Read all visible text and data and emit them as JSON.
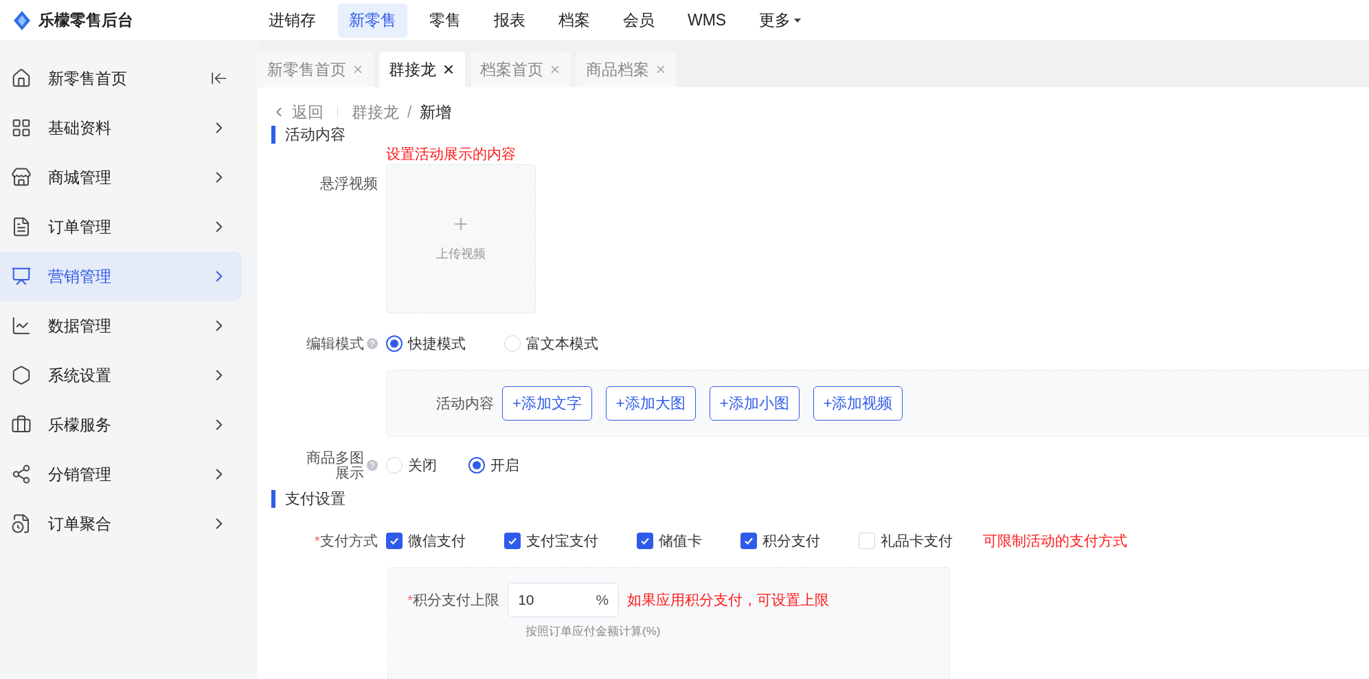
{
  "app": {
    "title": "乐檬零售后台"
  },
  "top_nav": [
    {
      "label": "进销存",
      "selected": false,
      "kind": "link"
    },
    {
      "label": "新零售",
      "selected": true,
      "kind": "link"
    },
    {
      "label": "零售",
      "selected": false,
      "kind": "link"
    },
    {
      "label": "报表",
      "selected": false,
      "kind": "link"
    },
    {
      "label": "档案",
      "selected": false,
      "kind": "link"
    },
    {
      "label": "会员",
      "selected": false,
      "kind": "link"
    },
    {
      "label": "WMS",
      "selected": false,
      "kind": "link"
    },
    {
      "label": "更多",
      "selected": false,
      "kind": "menu"
    }
  ],
  "sidebar": {
    "items": [
      {
        "label": "新零售首页",
        "selected": false,
        "kind": "home"
      },
      {
        "label": "基础资料",
        "selected": false,
        "kind": "group"
      },
      {
        "label": "商城管理",
        "selected": false,
        "kind": "group"
      },
      {
        "label": "订单管理",
        "selected": false,
        "kind": "group"
      },
      {
        "label": "营销管理",
        "selected": true,
        "kind": "group"
      },
      {
        "label": "数据管理",
        "selected": false,
        "kind": "group"
      },
      {
        "label": "系统设置",
        "selected": false,
        "kind": "group"
      },
      {
        "label": "乐檬服务",
        "selected": false,
        "kind": "group"
      },
      {
        "label": "分销管理",
        "selected": false,
        "kind": "group"
      },
      {
        "label": "订单聚合",
        "selected": false,
        "kind": "group"
      }
    ]
  },
  "tabs": [
    {
      "label": "新零售首页",
      "selected": false
    },
    {
      "label": "群接龙",
      "selected": true
    },
    {
      "label": "档案首页",
      "selected": false
    },
    {
      "label": "商品档案",
      "selected": false
    }
  ],
  "breadcrumb": {
    "back": "返回",
    "path": [
      "群接龙",
      "新增"
    ],
    "separator": "/"
  },
  "activity_section": {
    "heading": "活动内容",
    "note": "设置活动展示的内容",
    "floating_video": {
      "label": "悬浮视频",
      "upload": "上传视频"
    },
    "edit_mode": {
      "label": "编辑模式",
      "options": [
        {
          "label": "快捷模式",
          "selected": true
        },
        {
          "label": "富文本模式",
          "selected": false
        }
      ]
    },
    "content_panel": {
      "label": "活动内容",
      "buttons": [
        "+添加文字",
        "+添加大图",
        "+添加小图",
        "+添加视频"
      ]
    },
    "multi_image": {
      "label": "商品多图展示",
      "options": [
        {
          "label": "关闭",
          "selected": false
        },
        {
          "label": "开启",
          "selected": true
        }
      ]
    }
  },
  "payment_section": {
    "heading": "支付设置",
    "methods": {
      "required_mark": "*",
      "label": "支付方式",
      "note": "可限制活动的支付方式",
      "options": [
        {
          "label": "微信支付",
          "checked": true
        },
        {
          "label": "支付宝支付",
          "checked": true
        },
        {
          "label": "储值卡",
          "checked": true
        },
        {
          "label": "积分支付",
          "checked": true
        },
        {
          "label": "礼品卡支付",
          "checked": false
        }
      ]
    },
    "points_limit": {
      "required_mark": "*",
      "label": "积分支付上限",
      "value": "10",
      "unit": "%",
      "note": "如果应用积分支付，可设置上限",
      "hint": "按照订单应付金额计算(%)"
    }
  }
}
